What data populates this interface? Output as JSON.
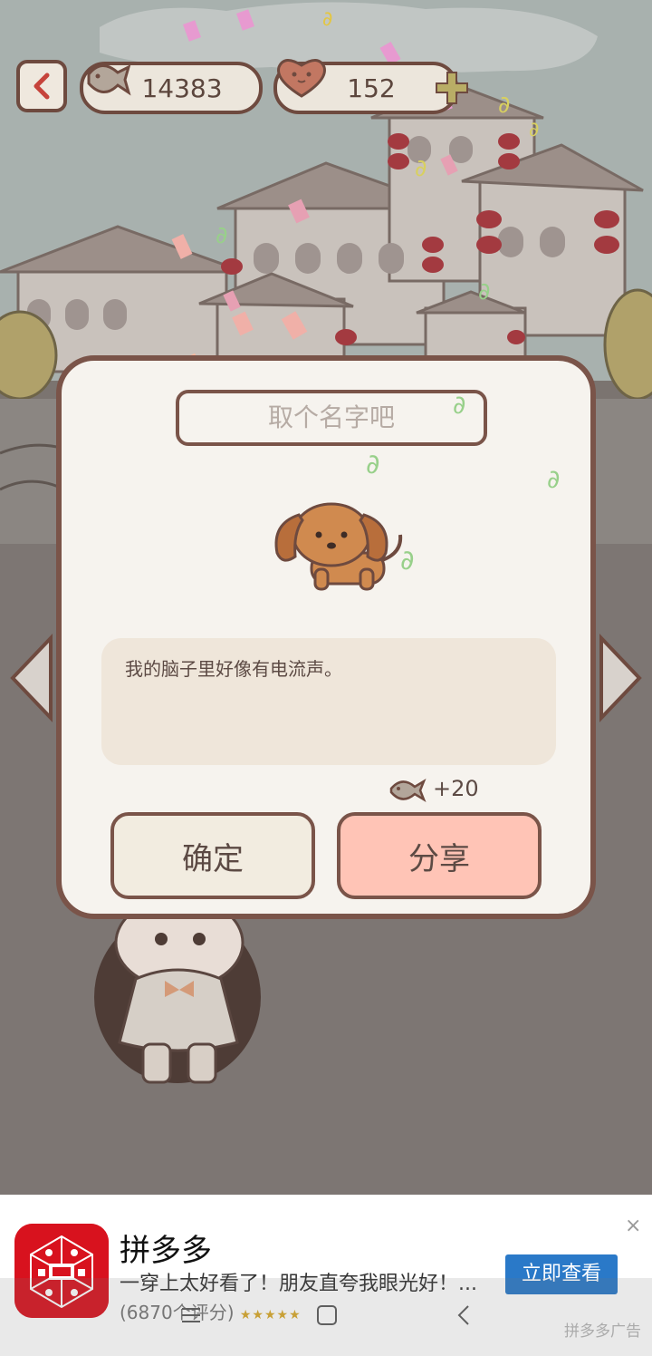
{
  "hud": {
    "fish_count": "14383",
    "heart_count": "152"
  },
  "dialog": {
    "name_placeholder": "取个名字吧",
    "message": "我的脑子里好像有电流声。",
    "reward_text": "+20",
    "confirm_label": "确定",
    "share_label": "分享"
  },
  "ad": {
    "title": "拼多多",
    "description": "一穿上太好看了！朋友直夸我眼光好！...",
    "rating_text": "(6870个评分)",
    "stars": "★★★★★",
    "cta_label": "立即查看",
    "close_symbol": "×",
    "tag": "拼多多广告"
  },
  "colors": {
    "dialog_border": "#7a5449",
    "share_button": "#ffc4b6",
    "ad_button": "#2a79c8",
    "logo_red": "#d8121e"
  },
  "icons": [
    "back-arrow-icon",
    "fish-icon",
    "heart-face-icon",
    "plus-icon",
    "dog-icon",
    "close-icon",
    "menu-icon",
    "home-icon",
    "back-icon"
  ]
}
